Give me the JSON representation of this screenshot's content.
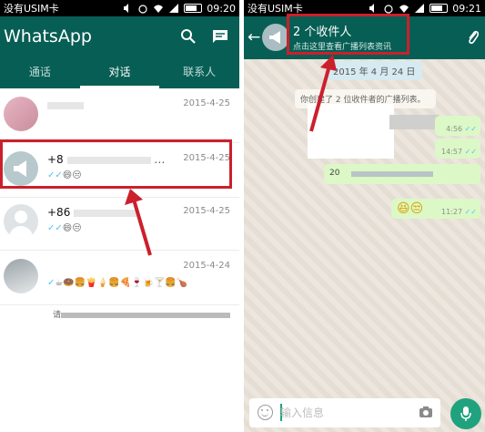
{
  "left_screen": {
    "status_bar": {
      "carrier": "没有USIM卡",
      "time": "09:20"
    },
    "header": {
      "app_title": "WhatsApp"
    },
    "tabs": [
      {
        "label": "通话",
        "active": false
      },
      {
        "label": "对话",
        "active": true
      },
      {
        "label": "联系人",
        "active": false
      }
    ],
    "chats": [
      {
        "name": "",
        "date": "2015-4-25",
        "preview": ""
      },
      {
        "name": "+8",
        "date": "2015-4-25",
        "preview": "😄😒"
      },
      {
        "name": "+86",
        "date": "2015-4-25",
        "preview": "😄😒"
      },
      {
        "name": "",
        "date": "2015-4-24",
        "preview": "☕🍩🍔🍟🍦🍔🍕🍷🍺🍸🍔🍗"
      }
    ],
    "footer_text": "请"
  },
  "right_screen": {
    "status_bar": {
      "carrier": "没有USIM卡",
      "time": "09:21"
    },
    "header": {
      "title": "2 个收件人",
      "subtitle": "点击这里查看广播列表资讯"
    },
    "date_chip": "2015 年 4 月 24 日",
    "system_message": "你创建了 2 位收件者的广播列表。",
    "messages": [
      {
        "time": "4:56"
      },
      {
        "time": "14:57"
      },
      {
        "text": "20"
      },
      {
        "emoji": "😆😒",
        "time": "11:27"
      }
    ],
    "input": {
      "placeholder": "输入信息"
    }
  },
  "colors": {
    "header": "#075e54",
    "accent": "#21a27e",
    "highlight": "#cc1f2c",
    "sent_bubble": "#dcf8c6",
    "tick": "#4fc3f7"
  },
  "icons": [
    "search-icon",
    "compose-icon",
    "back-icon",
    "attachment-icon",
    "emoji-icon",
    "camera-icon",
    "microphone-icon",
    "broadcast-icon"
  ]
}
